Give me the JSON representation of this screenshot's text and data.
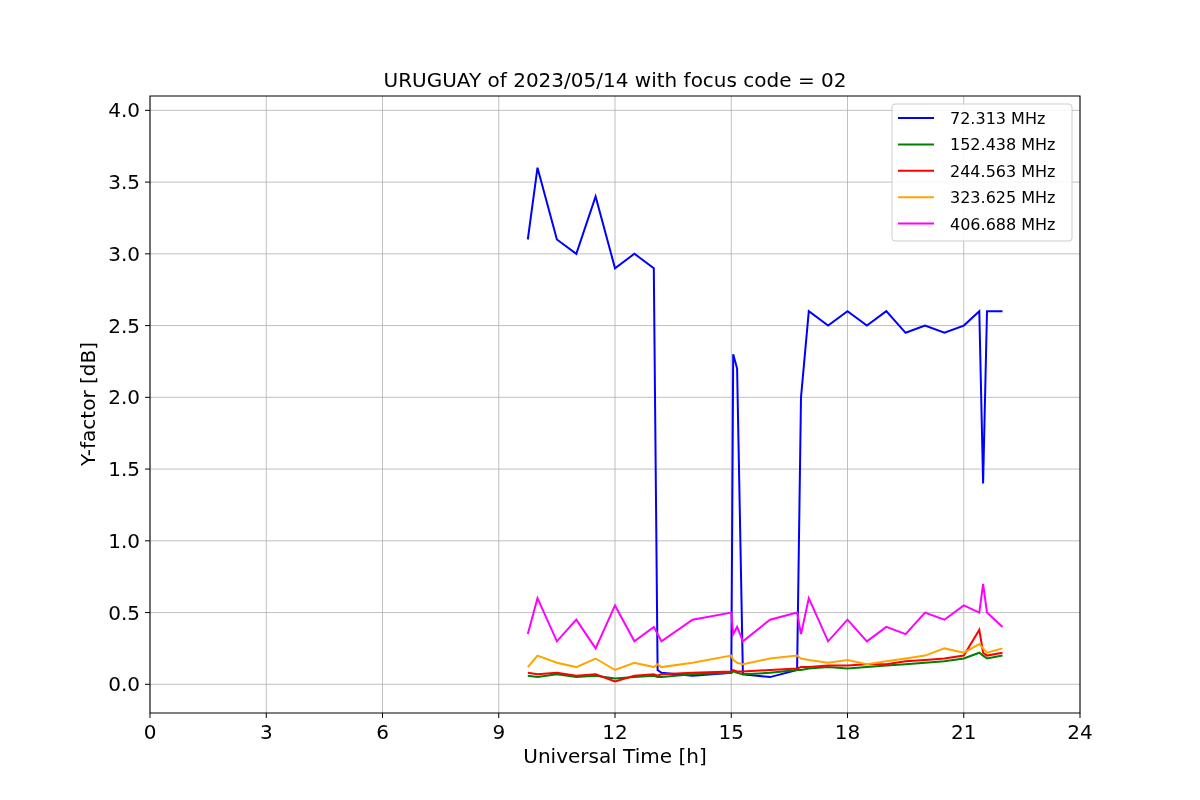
{
  "chart_data": {
    "type": "line",
    "title": "URUGUAY of 2023/05/14 with focus code = 02",
    "xlabel": "Universal Time [h]",
    "ylabel": "Y-factor [dB]",
    "x": [
      9.75,
      10,
      10.5,
      11,
      11.5,
      12,
      12.5,
      13,
      13.1,
      13.2,
      14,
      15,
      15.05,
      15.15,
      15.3,
      16,
      16.7,
      16.8,
      17,
      17.5,
      18,
      18.5,
      19,
      19.5,
      20,
      20.5,
      21,
      21.4,
      21.5,
      21.6,
      22
    ],
    "series": [
      {
        "name": "72.313 MHz",
        "color": "#0000ff",
        "values": [
          3.1,
          3.6,
          3.1,
          3.0,
          3.4,
          2.9,
          3.0,
          2.9,
          0.1,
          0.08,
          0.06,
          0.08,
          2.3,
          2.2,
          0.07,
          0.05,
          0.1,
          2.0,
          2.6,
          2.5,
          2.6,
          2.5,
          2.6,
          2.45,
          2.5,
          2.45,
          2.5,
          2.6,
          1.4,
          2.6,
          2.6
        ]
      },
      {
        "name": "152.438 MHz",
        "color": "#008000",
        "values": [
          0.06,
          0.05,
          0.07,
          0.05,
          0.06,
          0.04,
          0.05,
          0.06,
          0.05,
          0.05,
          0.07,
          0.08,
          0.09,
          0.08,
          0.07,
          0.08,
          0.1,
          0.1,
          0.11,
          0.12,
          0.11,
          0.12,
          0.13,
          0.14,
          0.15,
          0.16,
          0.18,
          0.22,
          0.2,
          0.18,
          0.2
        ]
      },
      {
        "name": "244.563 MHz",
        "color": "#ff0000",
        "values": [
          0.08,
          0.07,
          0.08,
          0.06,
          0.07,
          0.02,
          0.06,
          0.07,
          0.06,
          0.07,
          0.08,
          0.09,
          0.1,
          0.09,
          0.09,
          0.1,
          0.11,
          0.12,
          0.12,
          0.13,
          0.13,
          0.14,
          0.14,
          0.16,
          0.17,
          0.18,
          0.2,
          0.38,
          0.22,
          0.2,
          0.22
        ]
      },
      {
        "name": "323.625 MHz",
        "color": "#ffa500",
        "values": [
          0.12,
          0.2,
          0.15,
          0.12,
          0.18,
          0.1,
          0.15,
          0.12,
          0.14,
          0.12,
          0.15,
          0.2,
          0.17,
          0.15,
          0.14,
          0.18,
          0.2,
          0.18,
          0.17,
          0.15,
          0.17,
          0.14,
          0.16,
          0.18,
          0.2,
          0.25,
          0.22,
          0.28,
          0.25,
          0.22,
          0.25
        ]
      },
      {
        "name": "406.688 MHz",
        "color": "#ff00ff",
        "values": [
          0.35,
          0.6,
          0.3,
          0.45,
          0.25,
          0.55,
          0.3,
          0.4,
          0.35,
          0.3,
          0.45,
          0.5,
          0.35,
          0.4,
          0.3,
          0.45,
          0.5,
          0.35,
          0.6,
          0.3,
          0.45,
          0.3,
          0.4,
          0.35,
          0.5,
          0.45,
          0.55,
          0.5,
          0.7,
          0.5,
          0.4
        ]
      }
    ],
    "grid": true,
    "legend": true,
    "xlim": [
      0,
      24
    ],
    "ylim": [
      -0.2,
      4.1
    ],
    "xticks": [
      0,
      3,
      6,
      9,
      12,
      15,
      18,
      21,
      24
    ],
    "yticks": [
      {
        "value": 0,
        "label": "0.0"
      },
      {
        "value": 0.5,
        "label": "0.5"
      },
      {
        "value": 1,
        "label": "1.0"
      },
      {
        "value": 1.5,
        "label": "1.5"
      },
      {
        "value": 2,
        "label": "2.0"
      },
      {
        "value": 2.5,
        "label": "2.5"
      },
      {
        "value": 3,
        "label": "3.0"
      },
      {
        "value": 3.5,
        "label": "3.5"
      },
      {
        "value": 4,
        "label": "4.0"
      }
    ]
  }
}
